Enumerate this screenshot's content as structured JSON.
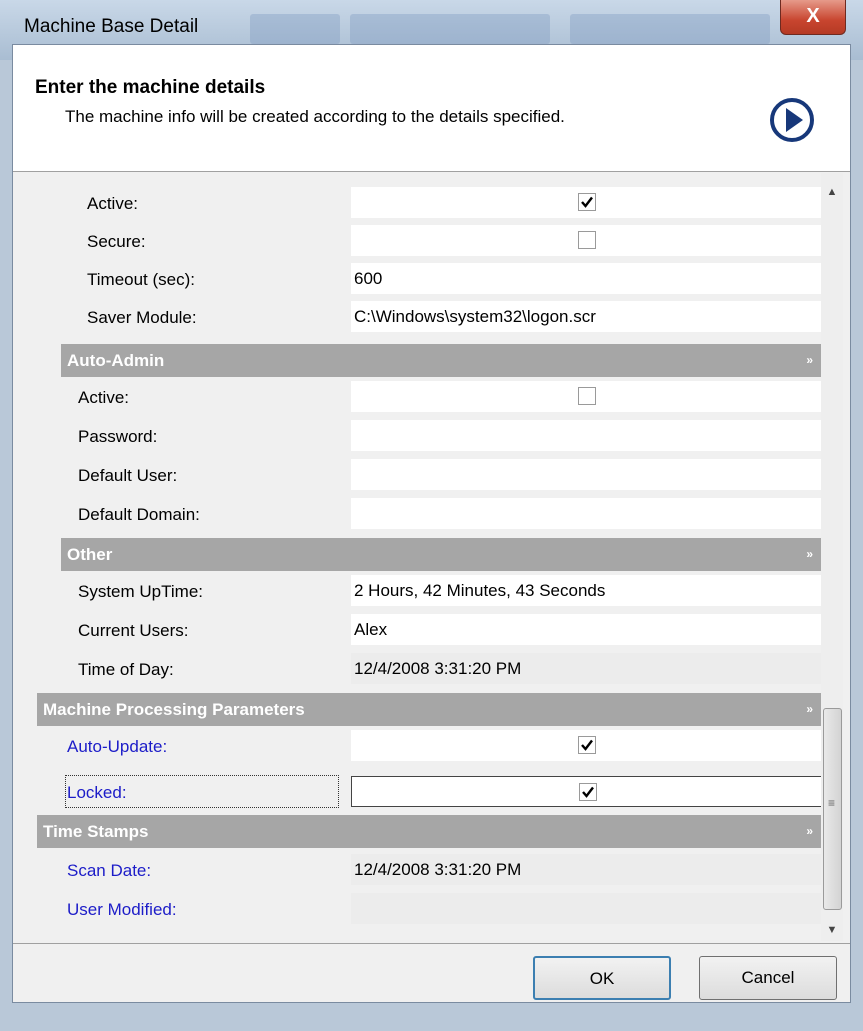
{
  "window": {
    "title": "Machine Base Detail",
    "close_label": "X"
  },
  "header": {
    "title": "Enter the machine details",
    "subtitle": "The machine info will be created according to the details specified.",
    "icon": "next-arrow-icon"
  },
  "screensaver": {
    "active_label": "Active:",
    "active_checked": true,
    "secure_label": "Secure:",
    "secure_checked": false,
    "timeout_label": "Timeout  (sec):",
    "timeout_value": "600",
    "saver_label": "Saver Module:",
    "saver_value": "C:\\Windows\\system32\\logon.scr"
  },
  "auto_admin": {
    "title": "Auto-Admin",
    "active_label": "Active:",
    "active_checked": false,
    "password_label": "Password:",
    "password_value": "",
    "default_user_label": "Default User:",
    "default_user_value": "",
    "default_domain_label": "Default Domain:",
    "default_domain_value": ""
  },
  "other": {
    "title": "Other",
    "uptime_label": "System UpTime:",
    "uptime_value": "2 Hours, 42 Minutes, 43 Seconds",
    "users_label": "Current Users:",
    "users_value": "Alex",
    "tod_label": "Time of Day:",
    "tod_value": "12/4/2008 3:31:20 PM"
  },
  "processing": {
    "title": "Machine Processing Parameters",
    "auto_update_label": "Auto-Update:",
    "auto_update_checked": true,
    "locked_label": "Locked:",
    "locked_checked": true
  },
  "timestamps": {
    "title": "Time Stamps",
    "scan_label": "Scan Date:",
    "scan_value": "12/4/2008 3:31:20 PM",
    "modified_label": "User Modified:",
    "modified_value": ""
  },
  "buttons": {
    "ok_label": "OK",
    "cancel_label": "Cancel"
  },
  "colors": {
    "category_bg": "#a6a6a6",
    "link_label": "#1c1cc8"
  }
}
